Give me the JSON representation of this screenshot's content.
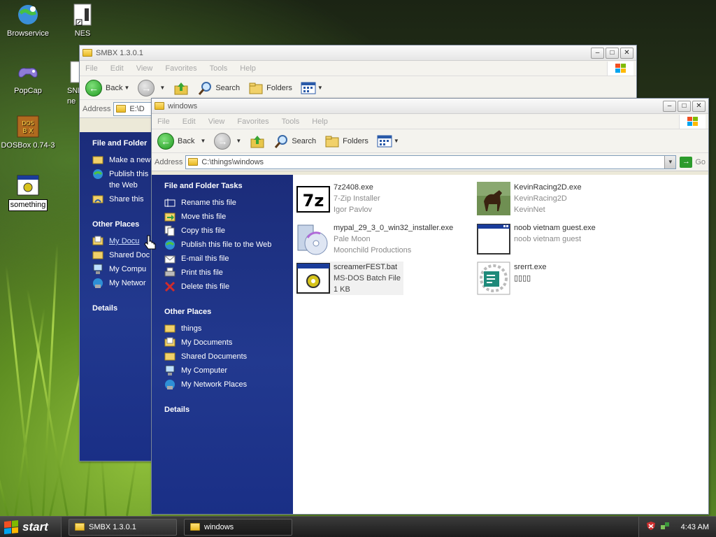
{
  "desktop": {
    "icons": [
      {
        "label": "Browservice"
      },
      {
        "label": "NES"
      },
      {
        "label": "PopCap"
      },
      {
        "label": "SNE ne"
      },
      {
        "label": "DOSBox 0.74-3"
      },
      {
        "label": "something"
      }
    ]
  },
  "back_window": {
    "title": "SMBX 1.3.0.1",
    "menu": [
      "File",
      "Edit",
      "View",
      "Favorites",
      "Tools",
      "Help"
    ],
    "toolbar": {
      "back": "Back",
      "search": "Search",
      "folders": "Folders"
    },
    "address_label": "Address",
    "address_value": "E:\\D",
    "tasks_head": "File and Folder",
    "tasks": [
      "Make a new",
      "Publish this the Web",
      "Share this"
    ],
    "other_head": "Other Places",
    "other": [
      "My Docu",
      "Shared Doc",
      "My Compu",
      "My Networ"
    ],
    "details_head": "Details"
  },
  "front_window": {
    "title": "windows",
    "menu": [
      "File",
      "Edit",
      "View",
      "Favorites",
      "Tools",
      "Help"
    ],
    "toolbar": {
      "back": "Back",
      "search": "Search",
      "folders": "Folders"
    },
    "address_label": "Address",
    "address_value": "C:\\things\\windows",
    "go_label": "Go",
    "tasks_head": "File and Folder Tasks",
    "tasks": [
      "Rename this file",
      "Move this file",
      "Copy this file",
      "Publish this file to the Web",
      "E-mail this file",
      "Print this file",
      "Delete this file"
    ],
    "other_head": "Other Places",
    "other": [
      "things",
      "My Documents",
      "Shared Documents",
      "My Computer",
      "My Network Places"
    ],
    "details_head": "Details",
    "files": [
      {
        "name": "7z2408.exe",
        "line2": "7-Zip Installer",
        "line3": "Igor Pavlov",
        "icon": "7zip-icon"
      },
      {
        "name": "KevinRacing2D.exe",
        "line2": "KevinRacing2D",
        "line3": "KevinNet",
        "icon": "horse-icon"
      },
      {
        "name": "mypal_29_3_0_win32_installer.exe",
        "line2": "Pale Moon",
        "line3": "Moonchild Productions",
        "icon": "installer-cd-icon"
      },
      {
        "name": "noob vietnam guest.exe",
        "line2": "noob vietnam guest",
        "line3": "",
        "icon": "window-app-icon"
      },
      {
        "name": "screamerFEST.bat",
        "line2": "MS-DOS Batch File",
        "line3": "1 KB",
        "icon": "batch-gear-icon"
      },
      {
        "name": "srerrt.exe",
        "line2": "▯▯▯▯",
        "line3": "",
        "icon": "setup-icon"
      }
    ]
  },
  "taskbar": {
    "start": "start",
    "tasks": [
      "SMBX 1.3.0.1",
      "windows"
    ],
    "clock": "4:43 AM"
  }
}
